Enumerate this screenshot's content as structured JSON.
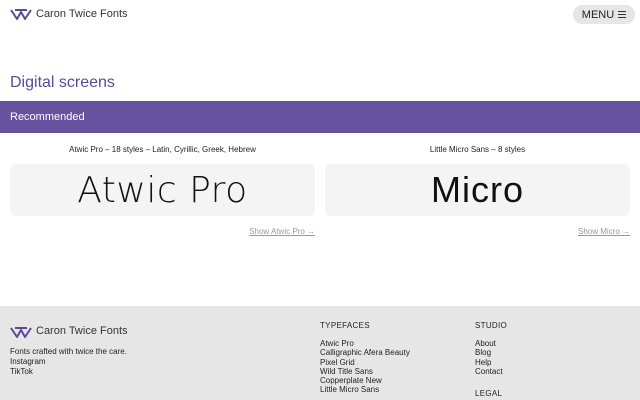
{
  "header": {
    "brand": "Caron Twice Fonts",
    "menu_label": "MENU",
    "logo_icon": "ct-logo-icon",
    "menu_icon": "hamburger-icon"
  },
  "page": {
    "title": "Digital screens",
    "section_label": "Recommended"
  },
  "cards": [
    {
      "caption": "Atwic Pro – 18 styles – Latin, Cyrillic, Greek, Hebrew",
      "sample": "Atwic Pro",
      "link": "Show Atwic Pro →"
    },
    {
      "caption": "Little Micro Sans – 8 styles",
      "sample": "Micro",
      "link": "Show Micro →"
    }
  ],
  "footer": {
    "brand": "Caron Twice Fonts",
    "tagline": "Fonts crafted with twice the care.",
    "social": [
      "Instagram",
      "TikTok"
    ],
    "typefaces_heading": "TYPEFACES",
    "typefaces": [
      "Atwic Pro",
      "Calligraphic Afera Beauty",
      "Pixel Grid",
      "Wild Title Sans",
      "Copperplate New",
      "Little Micro Sans"
    ],
    "studio_heading": "STUDIO",
    "studio": [
      "About",
      "Blog",
      "Help",
      "Contact"
    ],
    "legal_heading": "LEGAL"
  },
  "colors": {
    "accent": "#67529f",
    "title": "#5a4a9c",
    "footer_bg": "#e6e6e6",
    "card_bg": "#f4f4f4"
  }
}
